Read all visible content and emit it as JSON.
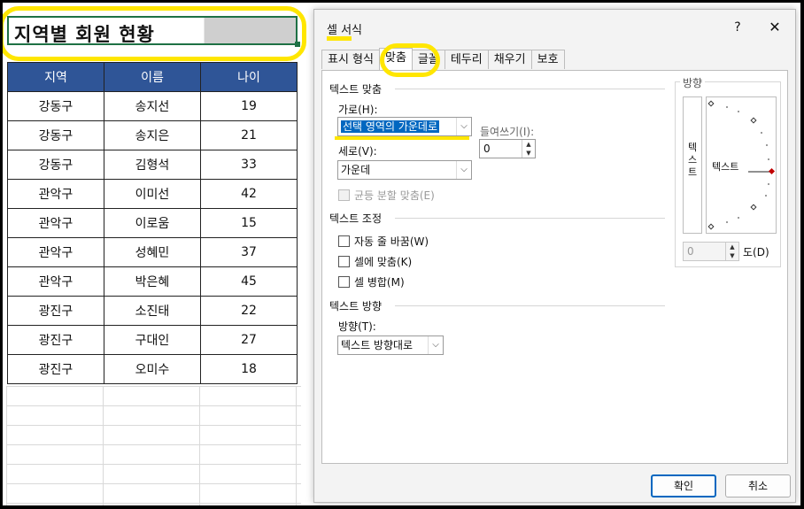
{
  "sheet": {
    "title": "지역별 회원 현황",
    "headers": [
      "지역",
      "이름",
      "나이"
    ],
    "rows": [
      [
        "강동구",
        "송지선",
        "19"
      ],
      [
        "강동구",
        "송지은",
        "21"
      ],
      [
        "강동구",
        "김형석",
        "33"
      ],
      [
        "관악구",
        "이미선",
        "42"
      ],
      [
        "관악구",
        "이로움",
        "15"
      ],
      [
        "관악구",
        "성혜민",
        "37"
      ],
      [
        "관악구",
        "박은혜",
        "45"
      ],
      [
        "광진구",
        "소진태",
        "22"
      ],
      [
        "광진구",
        "구대인",
        "27"
      ],
      [
        "광진구",
        "오미수",
        "18"
      ]
    ],
    "header_color": "#2f5597"
  },
  "dialog": {
    "title": "셀 서식",
    "help": "?",
    "close": "✕",
    "tabs": [
      "표시 형식",
      "맞춤",
      "글꼴",
      "테두리",
      "채우기",
      "보호"
    ],
    "active_tab": "맞춤",
    "text_align_section": "텍스트 맞춤",
    "horizontal_label": "가로(H):",
    "horizontal_value": "선택 영역의 가운데로",
    "indent_label": "들여쓰기(I):",
    "indent_value": "0",
    "vertical_label": "세로(V):",
    "vertical_value": "가운데",
    "justify_distributed": "균등 분할 맞춤(E)",
    "text_control_section": "텍스트 조정",
    "wrap_text": "자동 줄 바꿈(W)",
    "shrink_to_fit": "셀에 맞춤(K)",
    "merge_cells": "셀 병합(M)",
    "rtl_section": "텍스트 방향",
    "direction_label": "방향(T):",
    "direction_value": "텍스트 방향대로",
    "orientation_section": "방향",
    "orientation_vertical_text": "텍\n스\n트",
    "orientation_text": "텍스트",
    "degrees_value": "0",
    "degrees_label": "도(D)",
    "ok": "확인",
    "cancel": "취소"
  },
  "colors": {
    "highlight": "#ffe600",
    "selection": "#0067c0"
  }
}
